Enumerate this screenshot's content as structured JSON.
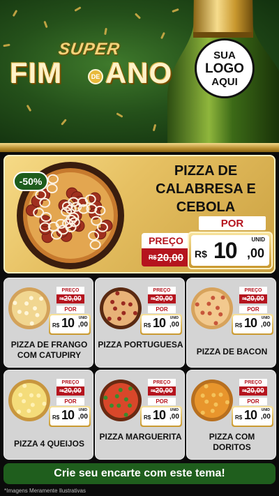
{
  "header": {
    "title_super": "SUPER",
    "title_fim": "FIM",
    "title_de": "DE",
    "title_ano": "ANO",
    "logo_placeholder": {
      "line1": "SUA",
      "line2": "LOGO",
      "line3": "AQUI"
    }
  },
  "featured": {
    "discount": "-50%",
    "name": "PIZZA DE CALABRESA E CEBOLA",
    "price_label": "PREÇO",
    "old_currency": "R$",
    "old_price": "20,00",
    "por_label": "POR",
    "unid_label": "UNID",
    "currency": "R$",
    "price_int": "10",
    "price_dec": ",00"
  },
  "products": [
    {
      "name": "PIZZA DE FRANGO COM CATUPIRY",
      "price_label": "PREÇO",
      "old_currency": "R$",
      "old_price": "20,00",
      "por_label": "POR",
      "unid_label": "UNID",
      "currency": "R$",
      "price_int": "10",
      "price_dec": ",00",
      "pizza_icon": "chicken-catupiry-pizza-icon"
    },
    {
      "name": "PIZZA PORTUGUESA",
      "price_label": "PREÇO",
      "old_currency": "R$",
      "old_price": "20,00",
      "por_label": "POR",
      "unid_label": "UNID",
      "currency": "R$",
      "price_int": "10",
      "price_dec": ",00",
      "pizza_icon": "portuguesa-pizza-icon"
    },
    {
      "name": "PIZZA DE BACON",
      "price_label": "PREÇO",
      "old_currency": "R$",
      "old_price": "20,00",
      "por_label": "POR",
      "unid_label": "UNID",
      "currency": "R$",
      "price_int": "10",
      "price_dec": ",00",
      "pizza_icon": "bacon-pizza-icon"
    },
    {
      "name": "PIZZA 4 QUEIJOS",
      "price_label": "PREÇO",
      "old_currency": "R$",
      "old_price": "20,00",
      "por_label": "POR",
      "unid_label": "UNID",
      "currency": "R$",
      "price_int": "10",
      "price_dec": ",00",
      "pizza_icon": "four-cheese-pizza-icon"
    },
    {
      "name": "PIZZA MARGUERITA",
      "price_label": "PREÇO",
      "old_currency": "R$",
      "old_price": "20,00",
      "por_label": "POR",
      "unid_label": "UNID",
      "currency": "R$",
      "price_int": "10",
      "price_dec": ",00",
      "pizza_icon": "margherita-pizza-icon"
    },
    {
      "name": "PIZZA COM DORITOS",
      "price_label": "PREÇO",
      "old_currency": "R$",
      "old_price": "20,00",
      "por_label": "POR",
      "unid_label": "UNID",
      "currency": "R$",
      "price_int": "10",
      "price_dec": ",00",
      "pizza_icon": "doritos-pizza-icon"
    }
  ],
  "cta": "Crie seu encarte com este tema!",
  "disclaimer": "*Imagens Meramente Ilustrativas",
  "colors": {
    "green": "#1f5e1d",
    "gold": "#e6c062",
    "red": "#b5141e",
    "card_gray": "#d4d4d4"
  }
}
